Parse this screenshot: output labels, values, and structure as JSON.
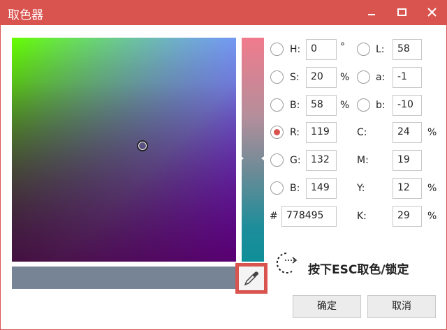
{
  "window": {
    "title": "取色器"
  },
  "controls": {
    "minimize": "minimize-icon",
    "maximize": "maximize-icon",
    "close": "close-icon"
  },
  "colors": {
    "accent": "#d9534f",
    "preview": "#778495"
  },
  "hsb": [
    {
      "label": "H:",
      "value": "0",
      "unit": "°",
      "checked": false
    },
    {
      "label": "S:",
      "value": "20",
      "unit": "%",
      "checked": false
    },
    {
      "label": "B:",
      "value": "58",
      "unit": "%",
      "checked": false
    }
  ],
  "lab": [
    {
      "label": "L:",
      "value": "58"
    },
    {
      "label": "a:",
      "value": "-1"
    },
    {
      "label": "b:",
      "value": "-10"
    }
  ],
  "rgb": [
    {
      "label": "R:",
      "value": "119",
      "checked": true
    },
    {
      "label": "G:",
      "value": "132",
      "checked": false
    },
    {
      "label": "B:",
      "value": "149",
      "checked": false
    }
  ],
  "cmyk": [
    {
      "label": "C:",
      "value": "24",
      "unit": "%"
    },
    {
      "label": "M:",
      "value": "19",
      "unit": ""
    },
    {
      "label": "Y:",
      "value": "12",
      "unit": "%"
    },
    {
      "label": "K:",
      "value": "29",
      "unit": "%"
    }
  ],
  "hex": {
    "label": "#",
    "value": "778495"
  },
  "hint": "按下ESC取色/锁定",
  "buttons": {
    "ok": "确定",
    "cancel": "取消"
  }
}
